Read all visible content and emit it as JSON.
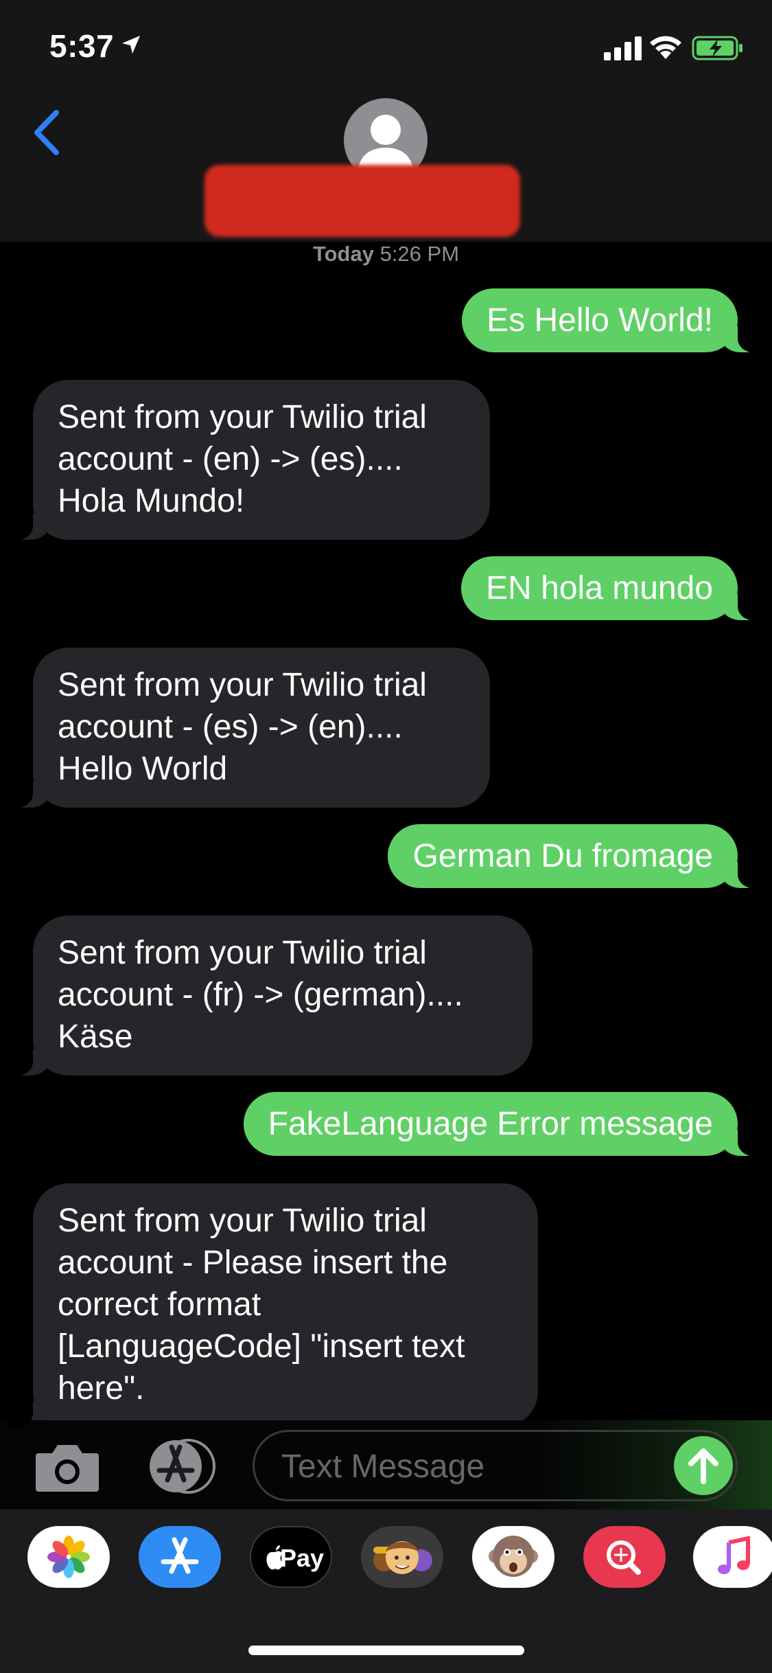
{
  "status_bar": {
    "time": "5:37"
  },
  "conversation": {
    "timestamp_day": "Today",
    "timestamp_time": "5:26 PM",
    "messages": [
      {
        "direction": "sent",
        "lines": [
          "Es Hello World!"
        ]
      },
      {
        "direction": "received",
        "lines": [
          "Sent from your Twilio trial",
          "account - (en) -> (es)....",
          "Hola Mundo!"
        ]
      },
      {
        "direction": "sent",
        "lines": [
          "EN hola mundo"
        ]
      },
      {
        "direction": "received",
        "lines": [
          "Sent from your Twilio trial",
          "account - (es) -> (en)....",
          "Hello World"
        ]
      },
      {
        "direction": "sent",
        "lines": [
          "German Du fromage"
        ]
      },
      {
        "direction": "received",
        "lines": [
          "Sent from your Twilio trial",
          "account - (fr) -> (german)....",
          "Käse"
        ]
      },
      {
        "direction": "sent",
        "lines": [
          "FakeLanguage Error message"
        ]
      },
      {
        "direction": "received",
        "lines": [
          "Sent from your Twilio trial",
          "account - Please insert the",
          "correct format",
          "[LanguageCode] \"insert text",
          "here\"."
        ]
      }
    ]
  },
  "composer": {
    "placeholder": "Text Message"
  },
  "app_drawer": {
    "apps": [
      "photos-icon",
      "app-store-icon",
      "apple-pay-icon",
      "memoji-icon",
      "animoji-icon",
      "images-search-icon",
      "music-icon"
    ],
    "apple_pay_label": "Pay"
  },
  "colors": {
    "sent_bubble": "#5fd066",
    "received_bubble": "#26252a",
    "accent_blue": "#2f7ff7"
  }
}
